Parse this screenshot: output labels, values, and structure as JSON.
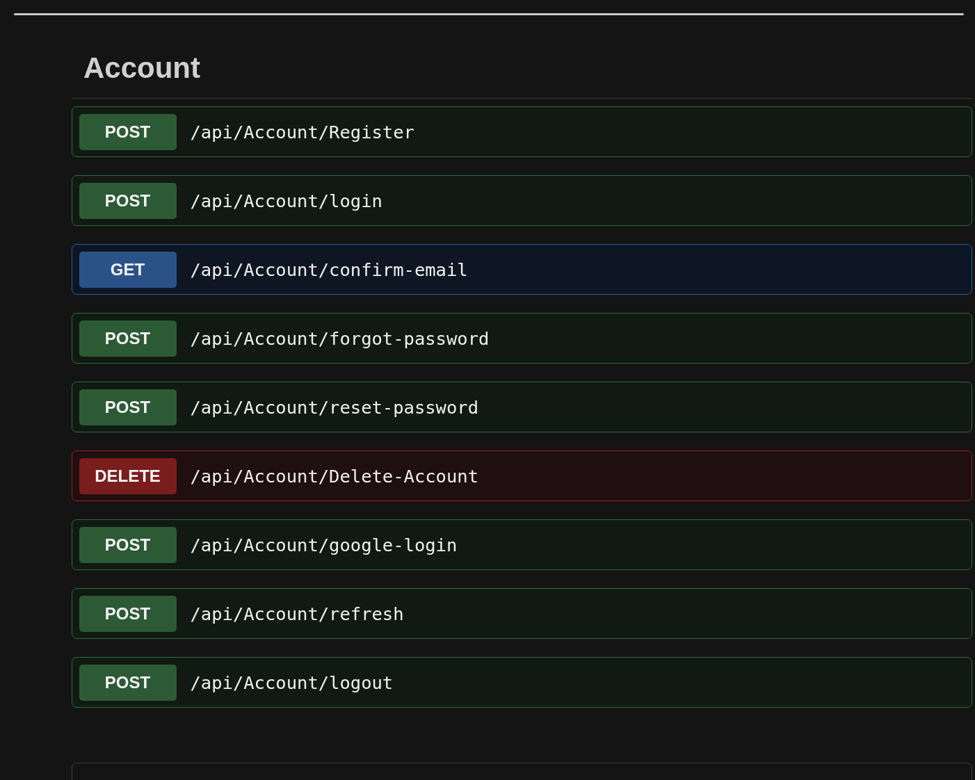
{
  "section": {
    "title": "Account"
  },
  "endpoints": [
    {
      "kind": "post",
      "method": "POST",
      "path": "/api/Account/Register"
    },
    {
      "kind": "post",
      "method": "POST",
      "path": "/api/Account/login"
    },
    {
      "kind": "get",
      "method": "GET",
      "path": "/api/Account/confirm-email"
    },
    {
      "kind": "post",
      "method": "POST",
      "path": "/api/Account/forgot-password"
    },
    {
      "kind": "post",
      "method": "POST",
      "path": "/api/Account/reset-password"
    },
    {
      "kind": "delete",
      "method": "DELETE",
      "path": "/api/Account/Delete-Account"
    },
    {
      "kind": "post",
      "method": "POST",
      "path": "/api/Account/google-login"
    },
    {
      "kind": "post",
      "method": "POST",
      "path": "/api/Account/refresh"
    },
    {
      "kind": "post",
      "method": "POST",
      "path": "/api/Account/logout"
    }
  ]
}
